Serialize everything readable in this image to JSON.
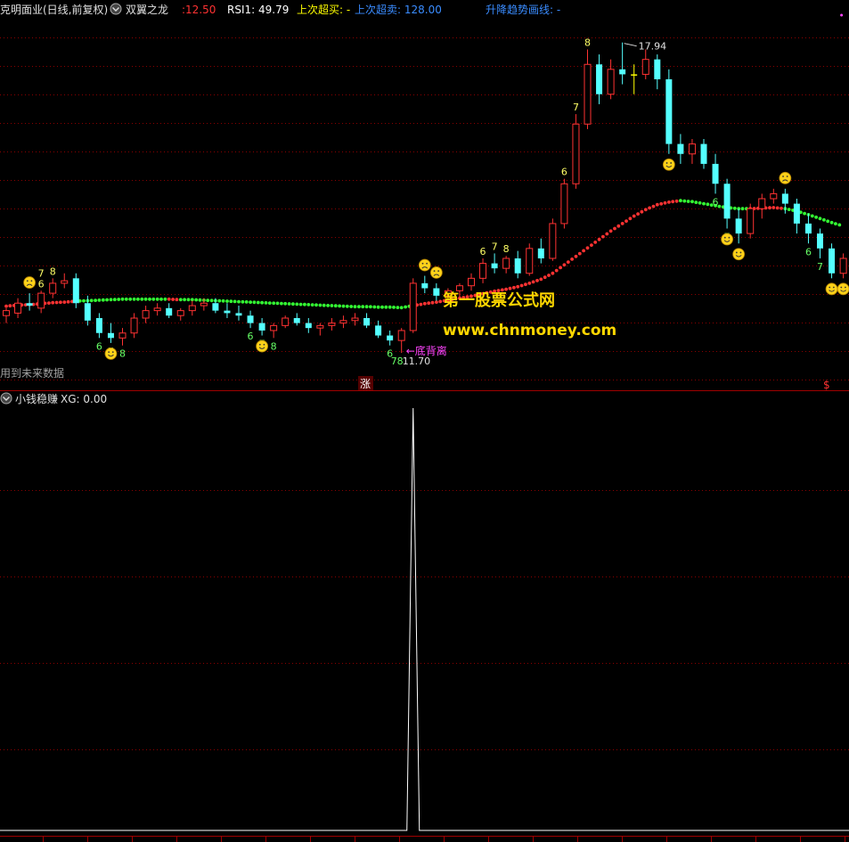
{
  "main_panel": {
    "header": {
      "stock_title": "克明面业(日线,前复权)",
      "indicator_name": "双翼之龙",
      "price_label": ":12.50",
      "rsi_label": "RSI1: 49.79",
      "last_overbuy": "上次超买: -",
      "last_oversell": "上次超卖: 128.00",
      "trend_line": "升降趋势画线: -"
    },
    "annotations": {
      "high_label": "17.94",
      "low_label": "11.70",
      "low_seq": "78",
      "divergence": "←底背离",
      "watermark_cn": "第一股票公式网",
      "watermark_url": "www.chnmoney.com",
      "future_note": "用到未来数据",
      "zhang_marker": "涨",
      "dollar_marker": "$"
    }
  },
  "sub_panel": {
    "name": "小钱稳赚",
    "xg_label": "XG: 0.00"
  },
  "colors": {
    "background": "#000000",
    "grid": "#8b0000",
    "up_candle": "#ff3232",
    "down_candle": "#54ffff",
    "flat_candle": "#ffff00",
    "ma_up": "#ff3232",
    "ma_down": "#33ff33",
    "xg_line": "#ffffff",
    "header_yellow": "#ffff00",
    "header_blue": "#3a8cff",
    "magenta": "#ff44ff",
    "watermark": "#ffd700"
  },
  "chart_data": {
    "type": "candlestick",
    "ylim": [
      11.2,
      18.4
    ],
    "candles": [
      [
        12.45,
        12.6,
        12.3,
        12.55
      ],
      [
        12.5,
        12.8,
        12.4,
        12.7
      ],
      [
        12.7,
        12.9,
        12.55,
        12.65
      ],
      [
        12.6,
        12.95,
        12.5,
        12.9
      ],
      [
        12.9,
        13.2,
        12.8,
        13.1
      ],
      [
        13.1,
        13.3,
        13.0,
        13.15
      ],
      [
        13.2,
        13.3,
        12.6,
        12.7
      ],
      [
        12.7,
        12.85,
        12.25,
        12.35
      ],
      [
        12.4,
        12.5,
        12.0,
        12.1
      ],
      [
        12.1,
        12.3,
        11.9,
        12.0
      ],
      [
        12.0,
        12.2,
        11.85,
        12.1
      ],
      [
        12.1,
        12.5,
        12.0,
        12.4
      ],
      [
        12.4,
        12.65,
        12.3,
        12.55
      ],
      [
        12.55,
        12.7,
        12.45,
        12.6
      ],
      [
        12.6,
        12.7,
        12.4,
        12.45
      ],
      [
        12.45,
        12.6,
        12.35,
        12.55
      ],
      [
        12.55,
        12.75,
        12.45,
        12.65
      ],
      [
        12.65,
        12.8,
        12.55,
        12.7
      ],
      [
        12.7,
        12.8,
        12.5,
        12.55
      ],
      [
        12.55,
        12.7,
        12.4,
        12.5
      ],
      [
        12.5,
        12.65,
        12.35,
        12.45
      ],
      [
        12.45,
        12.55,
        12.2,
        12.3
      ],
      [
        12.3,
        12.4,
        12.05,
        12.15
      ],
      [
        12.15,
        12.3,
        12.0,
        12.25
      ],
      [
        12.25,
        12.45,
        12.2,
        12.4
      ],
      [
        12.4,
        12.5,
        12.25,
        12.3
      ],
      [
        12.3,
        12.4,
        12.1,
        12.2
      ],
      [
        12.2,
        12.3,
        12.05,
        12.25
      ],
      [
        12.25,
        12.4,
        12.15,
        12.3
      ],
      [
        12.3,
        12.45,
        12.2,
        12.35
      ],
      [
        12.35,
        12.5,
        12.25,
        12.4
      ],
      [
        12.4,
        12.5,
        12.2,
        12.25
      ],
      [
        12.25,
        12.35,
        12.0,
        12.05
      ],
      [
        12.05,
        12.15,
        11.85,
        11.95
      ],
      [
        11.95,
        12.2,
        11.7,
        12.15
      ],
      [
        12.15,
        13.2,
        12.1,
        13.1
      ],
      [
        13.1,
        13.25,
        12.9,
        13.0
      ],
      [
        13.0,
        13.1,
        12.75,
        12.85
      ],
      [
        12.85,
        13.0,
        12.7,
        12.95
      ],
      [
        12.95,
        13.1,
        12.8,
        13.05
      ],
      [
        13.05,
        13.3,
        12.95,
        13.2
      ],
      [
        13.2,
        13.6,
        13.1,
        13.5
      ],
      [
        13.5,
        13.7,
        13.3,
        13.4
      ],
      [
        13.4,
        13.65,
        13.3,
        13.6
      ],
      [
        13.6,
        13.75,
        13.2,
        13.3
      ],
      [
        13.3,
        13.9,
        13.25,
        13.8
      ],
      [
        13.8,
        14.0,
        13.5,
        13.6
      ],
      [
        13.6,
        14.4,
        13.55,
        14.3
      ],
      [
        14.3,
        15.2,
        14.2,
        15.1
      ],
      [
        15.1,
        16.5,
        15.0,
        16.3
      ],
      [
        16.3,
        17.8,
        16.2,
        17.5
      ],
      [
        17.5,
        17.7,
        16.7,
        16.9
      ],
      [
        16.9,
        17.6,
        16.8,
        17.4
      ],
      [
        17.4,
        17.94,
        17.1,
        17.3
      ],
      [
        17.3,
        17.5,
        16.9,
        17.3
      ],
      [
        17.3,
        17.8,
        17.2,
        17.6
      ],
      [
        17.6,
        17.7,
        17.0,
        17.2
      ],
      [
        17.2,
        17.4,
        15.7,
        15.9
      ],
      [
        15.9,
        16.1,
        15.5,
        15.7
      ],
      [
        15.7,
        16.0,
        15.5,
        15.9
      ],
      [
        15.9,
        16.0,
        15.4,
        15.5
      ],
      [
        15.5,
        15.7,
        14.9,
        15.1
      ],
      [
        15.1,
        15.2,
        14.2,
        14.4
      ],
      [
        14.4,
        14.6,
        13.9,
        14.1
      ],
      [
        14.1,
        14.7,
        14.0,
        14.6
      ],
      [
        14.6,
        14.9,
        14.4,
        14.8
      ],
      [
        14.8,
        15.0,
        14.7,
        14.9
      ],
      [
        14.9,
        15.0,
        14.5,
        14.7
      ],
      [
        14.7,
        14.8,
        14.1,
        14.3
      ],
      [
        14.3,
        14.5,
        13.9,
        14.1
      ],
      [
        14.1,
        14.2,
        13.6,
        13.8
      ],
      [
        13.8,
        13.9,
        13.2,
        13.3
      ],
      [
        13.3,
        13.7,
        13.2,
        13.6
      ]
    ],
    "ma_line": [
      12.64,
      12.66,
      12.67,
      12.69,
      12.71,
      12.72,
      12.74,
      12.75,
      12.76,
      12.77,
      12.78,
      12.78,
      12.78,
      12.78,
      12.78,
      12.77,
      12.77,
      12.76,
      12.75,
      12.74,
      12.73,
      12.72,
      12.71,
      12.7,
      12.69,
      12.68,
      12.67,
      12.66,
      12.65,
      12.64,
      12.63,
      12.63,
      12.62,
      12.62,
      12.61,
      12.65,
      12.69,
      12.72,
      12.76,
      12.8,
      12.84,
      12.89,
      12.94,
      12.98,
      13.03,
      13.1,
      13.18,
      13.3,
      13.47,
      13.64,
      13.81,
      13.98,
      14.15,
      14.3,
      14.45,
      14.58,
      14.68,
      14.73,
      14.76,
      14.74,
      14.7,
      14.66,
      14.62,
      14.6,
      14.6,
      14.61,
      14.62,
      14.6,
      14.55,
      14.48,
      14.4,
      14.32,
      14.25
    ],
    "ma_up_flags": [
      1,
      1,
      1,
      1,
      1,
      1,
      0,
      0,
      0,
      0,
      0,
      0,
      0,
      0,
      1,
      0,
      0,
      0,
      0,
      0,
      0,
      0,
      0,
      0,
      0,
      0,
      0,
      0,
      0,
      0,
      0,
      0,
      0,
      0,
      0,
      1,
      1,
      1,
      1,
      1,
      1,
      1,
      1,
      1,
      1,
      1,
      1,
      1,
      1,
      1,
      1,
      1,
      1,
      1,
      1,
      1,
      1,
      1,
      0,
      0,
      0,
      0,
      0,
      0,
      1,
      1,
      1,
      0,
      0,
      0,
      0,
      0,
      0
    ],
    "xg_values": [
      0,
      0,
      0,
      0,
      0,
      0,
      0,
      0,
      0,
      0,
      0,
      0,
      0,
      0,
      0,
      0,
      0,
      0,
      0,
      0,
      0,
      0,
      0,
      0,
      0,
      0,
      0,
      0,
      0,
      0,
      0,
      0,
      0,
      0,
      0,
      1,
      0,
      0,
      0,
      0,
      0,
      0,
      0,
      0,
      0,
      0,
      0,
      0,
      0,
      0,
      0,
      0,
      0,
      0,
      0,
      0,
      0,
      0,
      0,
      0,
      0,
      0,
      0,
      0,
      0,
      0,
      0,
      0,
      0,
      0,
      0,
      0,
      0
    ],
    "xg_ylim": [
      0,
      1
    ],
    "seq_labels": [
      {
        "i": 3,
        "text": "6",
        "color": "#ffff66",
        "pos": "above"
      },
      {
        "i": 3,
        "text": "7",
        "color": "#ffff66",
        "pos": "above2"
      },
      {
        "i": 4,
        "text": "8",
        "color": "#ffff66",
        "pos": "above"
      },
      {
        "i": 8,
        "text": "6",
        "color": "#66ff66",
        "pos": "below"
      },
      {
        "i": 9,
        "text": "7",
        "color": "#66ff66",
        "pos": "below"
      },
      {
        "i": 10,
        "text": "8",
        "color": "#66ff66",
        "pos": "below"
      },
      {
        "i": 21,
        "text": "6",
        "color": "#66ff66",
        "pos": "below"
      },
      {
        "i": 22,
        "text": "7",
        "color": "#66ff66",
        "pos": "below"
      },
      {
        "i": 23,
        "text": "8",
        "color": "#66ff66",
        "pos": "below"
      },
      {
        "i": 33,
        "text": "6",
        "color": "#66ff66",
        "pos": "below"
      },
      {
        "i": 41,
        "text": "6",
        "color": "#ffff66",
        "pos": "above"
      },
      {
        "i": 42,
        "text": "7",
        "color": "#ffff66",
        "pos": "above"
      },
      {
        "i": 43,
        "text": "8",
        "color": "#ffff66",
        "pos": "above"
      },
      {
        "i": 48,
        "text": "6",
        "color": "#ffff66",
        "pos": "above"
      },
      {
        "i": 49,
        "text": "7",
        "color": "#ffff66",
        "pos": "above"
      },
      {
        "i": 50,
        "text": "8",
        "color": "#ffff66",
        "pos": "above"
      },
      {
        "i": 61,
        "text": "6",
        "color": "#66ff66",
        "pos": "below"
      },
      {
        "i": 62,
        "text": "7",
        "color": "#66ff66",
        "pos": "below"
      },
      {
        "i": 69,
        "text": "6",
        "color": "#66ff66",
        "pos": "below"
      },
      {
        "i": 70,
        "text": "7",
        "color": "#66ff66",
        "pos": "below"
      },
      {
        "i": 71,
        "text": "8",
        "color": "#66ff66",
        "pos": "below"
      }
    ],
    "smileys": [
      {
        "i": 2,
        "kind": "sad",
        "pos": "above"
      },
      {
        "i": 9,
        "kind": "happy",
        "pos": "below"
      },
      {
        "i": 22,
        "kind": "happy",
        "pos": "below"
      },
      {
        "i": 36,
        "kind": "sad",
        "pos": "above"
      },
      {
        "i": 37,
        "kind": "sad",
        "pos": "above"
      },
      {
        "i": 57,
        "kind": "happy",
        "pos": "below"
      },
      {
        "i": 62,
        "kind": "happy",
        "pos": "below"
      },
      {
        "i": 63,
        "kind": "happy",
        "pos": "below"
      },
      {
        "i": 67,
        "kind": "sad",
        "pos": "above"
      },
      {
        "i": 71,
        "kind": "happy",
        "pos": "below"
      },
      {
        "i": 72,
        "kind": "happy",
        "pos": "below"
      }
    ],
    "top_dots": [
      72,
      73,
      76,
      79,
      82,
      85,
      88,
      91,
      94
    ]
  }
}
